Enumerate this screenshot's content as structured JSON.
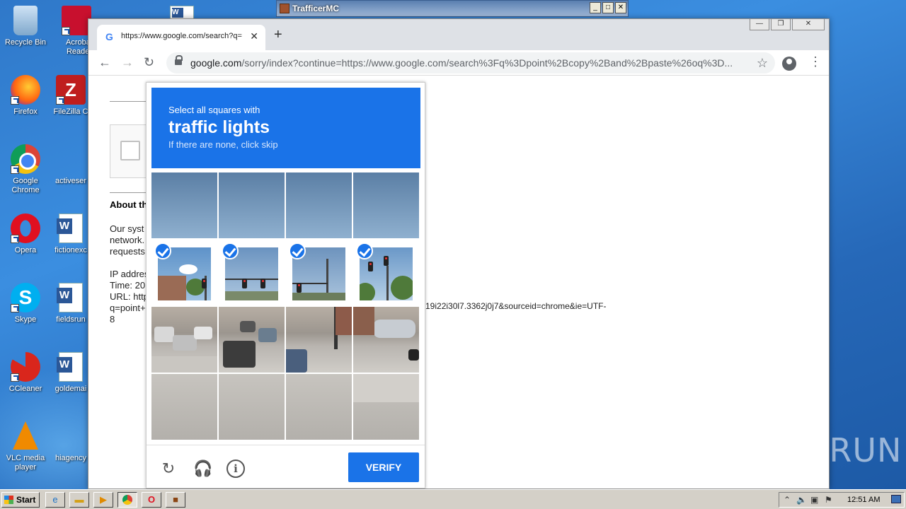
{
  "desktop": {
    "icons": [
      {
        "label": "Recycle Bin",
        "icon": "recycle-bin-icon"
      },
      {
        "label": "Acrobat Reader",
        "icon": "acrobat-icon"
      },
      {
        "label": "Firefox",
        "icon": "firefox-icon"
      },
      {
        "label": "FileZilla C",
        "icon": "filezilla-icon"
      },
      {
        "label": "Google Chrome",
        "icon": "chrome-icon"
      },
      {
        "label": "activeser",
        "icon": "blank-file-icon"
      },
      {
        "label": "Opera",
        "icon": "opera-icon"
      },
      {
        "label": "fictionexc",
        "icon": "word-doc-icon"
      },
      {
        "label": "Skype",
        "icon": "skype-icon"
      },
      {
        "label": "fieldsrun",
        "icon": "word-doc-icon"
      },
      {
        "label": "CCleaner",
        "icon": "ccleaner-icon"
      },
      {
        "label": "goldemai",
        "icon": "word-doc-icon"
      },
      {
        "label": "VLC media player",
        "icon": "vlc-icon"
      },
      {
        "label": "hiagency",
        "icon": "blank-file-icon"
      }
    ]
  },
  "trafficer_window": {
    "title": "TrafficerMC"
  },
  "browser": {
    "tab_title": "https://www.google.com/search?q=",
    "url_host": "google.com",
    "url_rest": "/sorry/index?continue=https://www.google.com/search%3Fq%3Dpoint%2Bcopy%2Band%2Bpaste%26oq%3D..."
  },
  "page": {
    "about_heading": "About th",
    "para1": [
      "Our syst",
      "network.",
      "requests"
    ],
    "para2": [
      "IP addres",
      "Time: 20",
      "URL: http",
      "q=point+",
      "8"
    ],
    "url_tail": "19i22i30l7.3362j0j7&sourceid=chrome&ie=UTF-"
  },
  "captcha": {
    "instruction": "Select all squares with",
    "target": "traffic lights",
    "hint": "If there are none, click skip",
    "verify_label": "VERIFY"
  },
  "watermark": "ANY▷RUN",
  "taskbar": {
    "start_label": "Start",
    "clock": "12:51 AM"
  }
}
